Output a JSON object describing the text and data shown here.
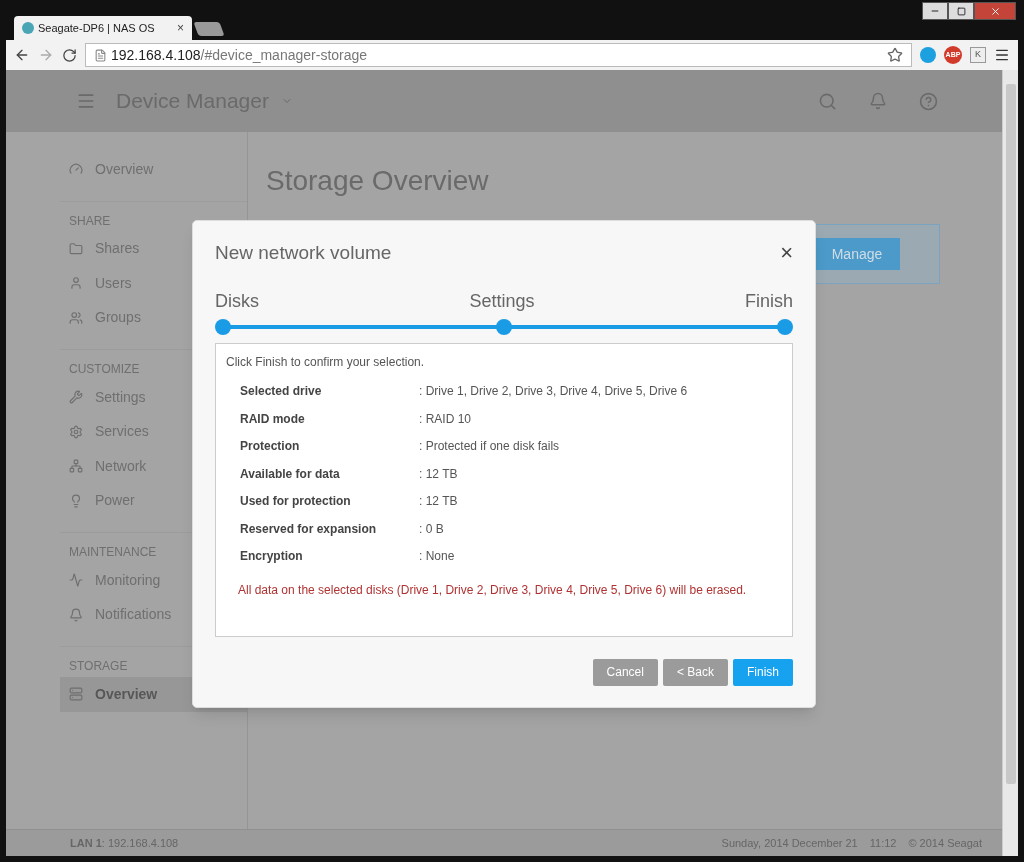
{
  "browser": {
    "tab_title": "Seagate-DP6 | NAS OS",
    "tab_close": "×",
    "url_host": "192.168.4.108",
    "url_path": "/#device_manager-storage",
    "abp": "ABP",
    "ext": "K"
  },
  "header": {
    "title": "Device Manager"
  },
  "sidebar": {
    "sections": [
      {
        "items": [
          {
            "label": "Overview",
            "selected": false
          }
        ]
      },
      {
        "heading": "SHARE",
        "items": [
          {
            "label": "Shares",
            "selected": false
          },
          {
            "label": "Users",
            "selected": false
          },
          {
            "label": "Groups",
            "selected": false
          }
        ]
      },
      {
        "heading": "CUSTOMIZE",
        "items": [
          {
            "label": "Settings",
            "selected": false
          },
          {
            "label": "Services",
            "selected": false
          },
          {
            "label": "Network",
            "selected": false
          },
          {
            "label": "Power",
            "selected": false
          }
        ]
      },
      {
        "heading": "MAINTENANCE",
        "items": [
          {
            "label": "Monitoring",
            "selected": false
          },
          {
            "label": "Notifications",
            "selected": false
          }
        ]
      },
      {
        "heading": "STORAGE",
        "items": [
          {
            "label": "Overview",
            "selected": true
          }
        ]
      }
    ]
  },
  "main": {
    "title": "Storage Overview",
    "manage_button": "Manage"
  },
  "dialog": {
    "title": "New network volume",
    "close": "×",
    "steps": [
      {
        "label": "Disks",
        "done": true
      },
      {
        "label": "Settings",
        "done": true
      },
      {
        "label": "Finish",
        "done": true
      }
    ],
    "intro": "Click Finish to confirm your selection.",
    "rows": [
      {
        "label": "Selected drive",
        "value": ": Drive 1, Drive 2, Drive 3, Drive 4, Drive 5, Drive 6"
      },
      {
        "label": "RAID mode",
        "value": ": RAID 10"
      },
      {
        "label": "Protection",
        "value": ": Protected if one disk fails"
      },
      {
        "label": "Available for data",
        "value": ": 12 TB"
      },
      {
        "label": "Used for protection",
        "value": ": 12 TB"
      },
      {
        "label": "Reserved for expansion",
        "value": ": 0 B"
      },
      {
        "label": "Encryption",
        "value": ": None"
      }
    ],
    "warning": "All data on the selected disks (Drive 1, Drive 2, Drive 3, Drive 4, Drive 5, Drive 6) will be erased.",
    "buttons": [
      {
        "label": "Cancel",
        "kind": "secondary"
      },
      {
        "label": "< Back",
        "kind": "secondary"
      },
      {
        "label": "Finish",
        "kind": "primary"
      }
    ]
  },
  "footer": {
    "lan_label": "LAN 1",
    "lan_value": ": 192.168.4.108",
    "date": "Sunday, 2014 December 21",
    "time": "11:12",
    "copyright": "© 2014 Seagat"
  }
}
